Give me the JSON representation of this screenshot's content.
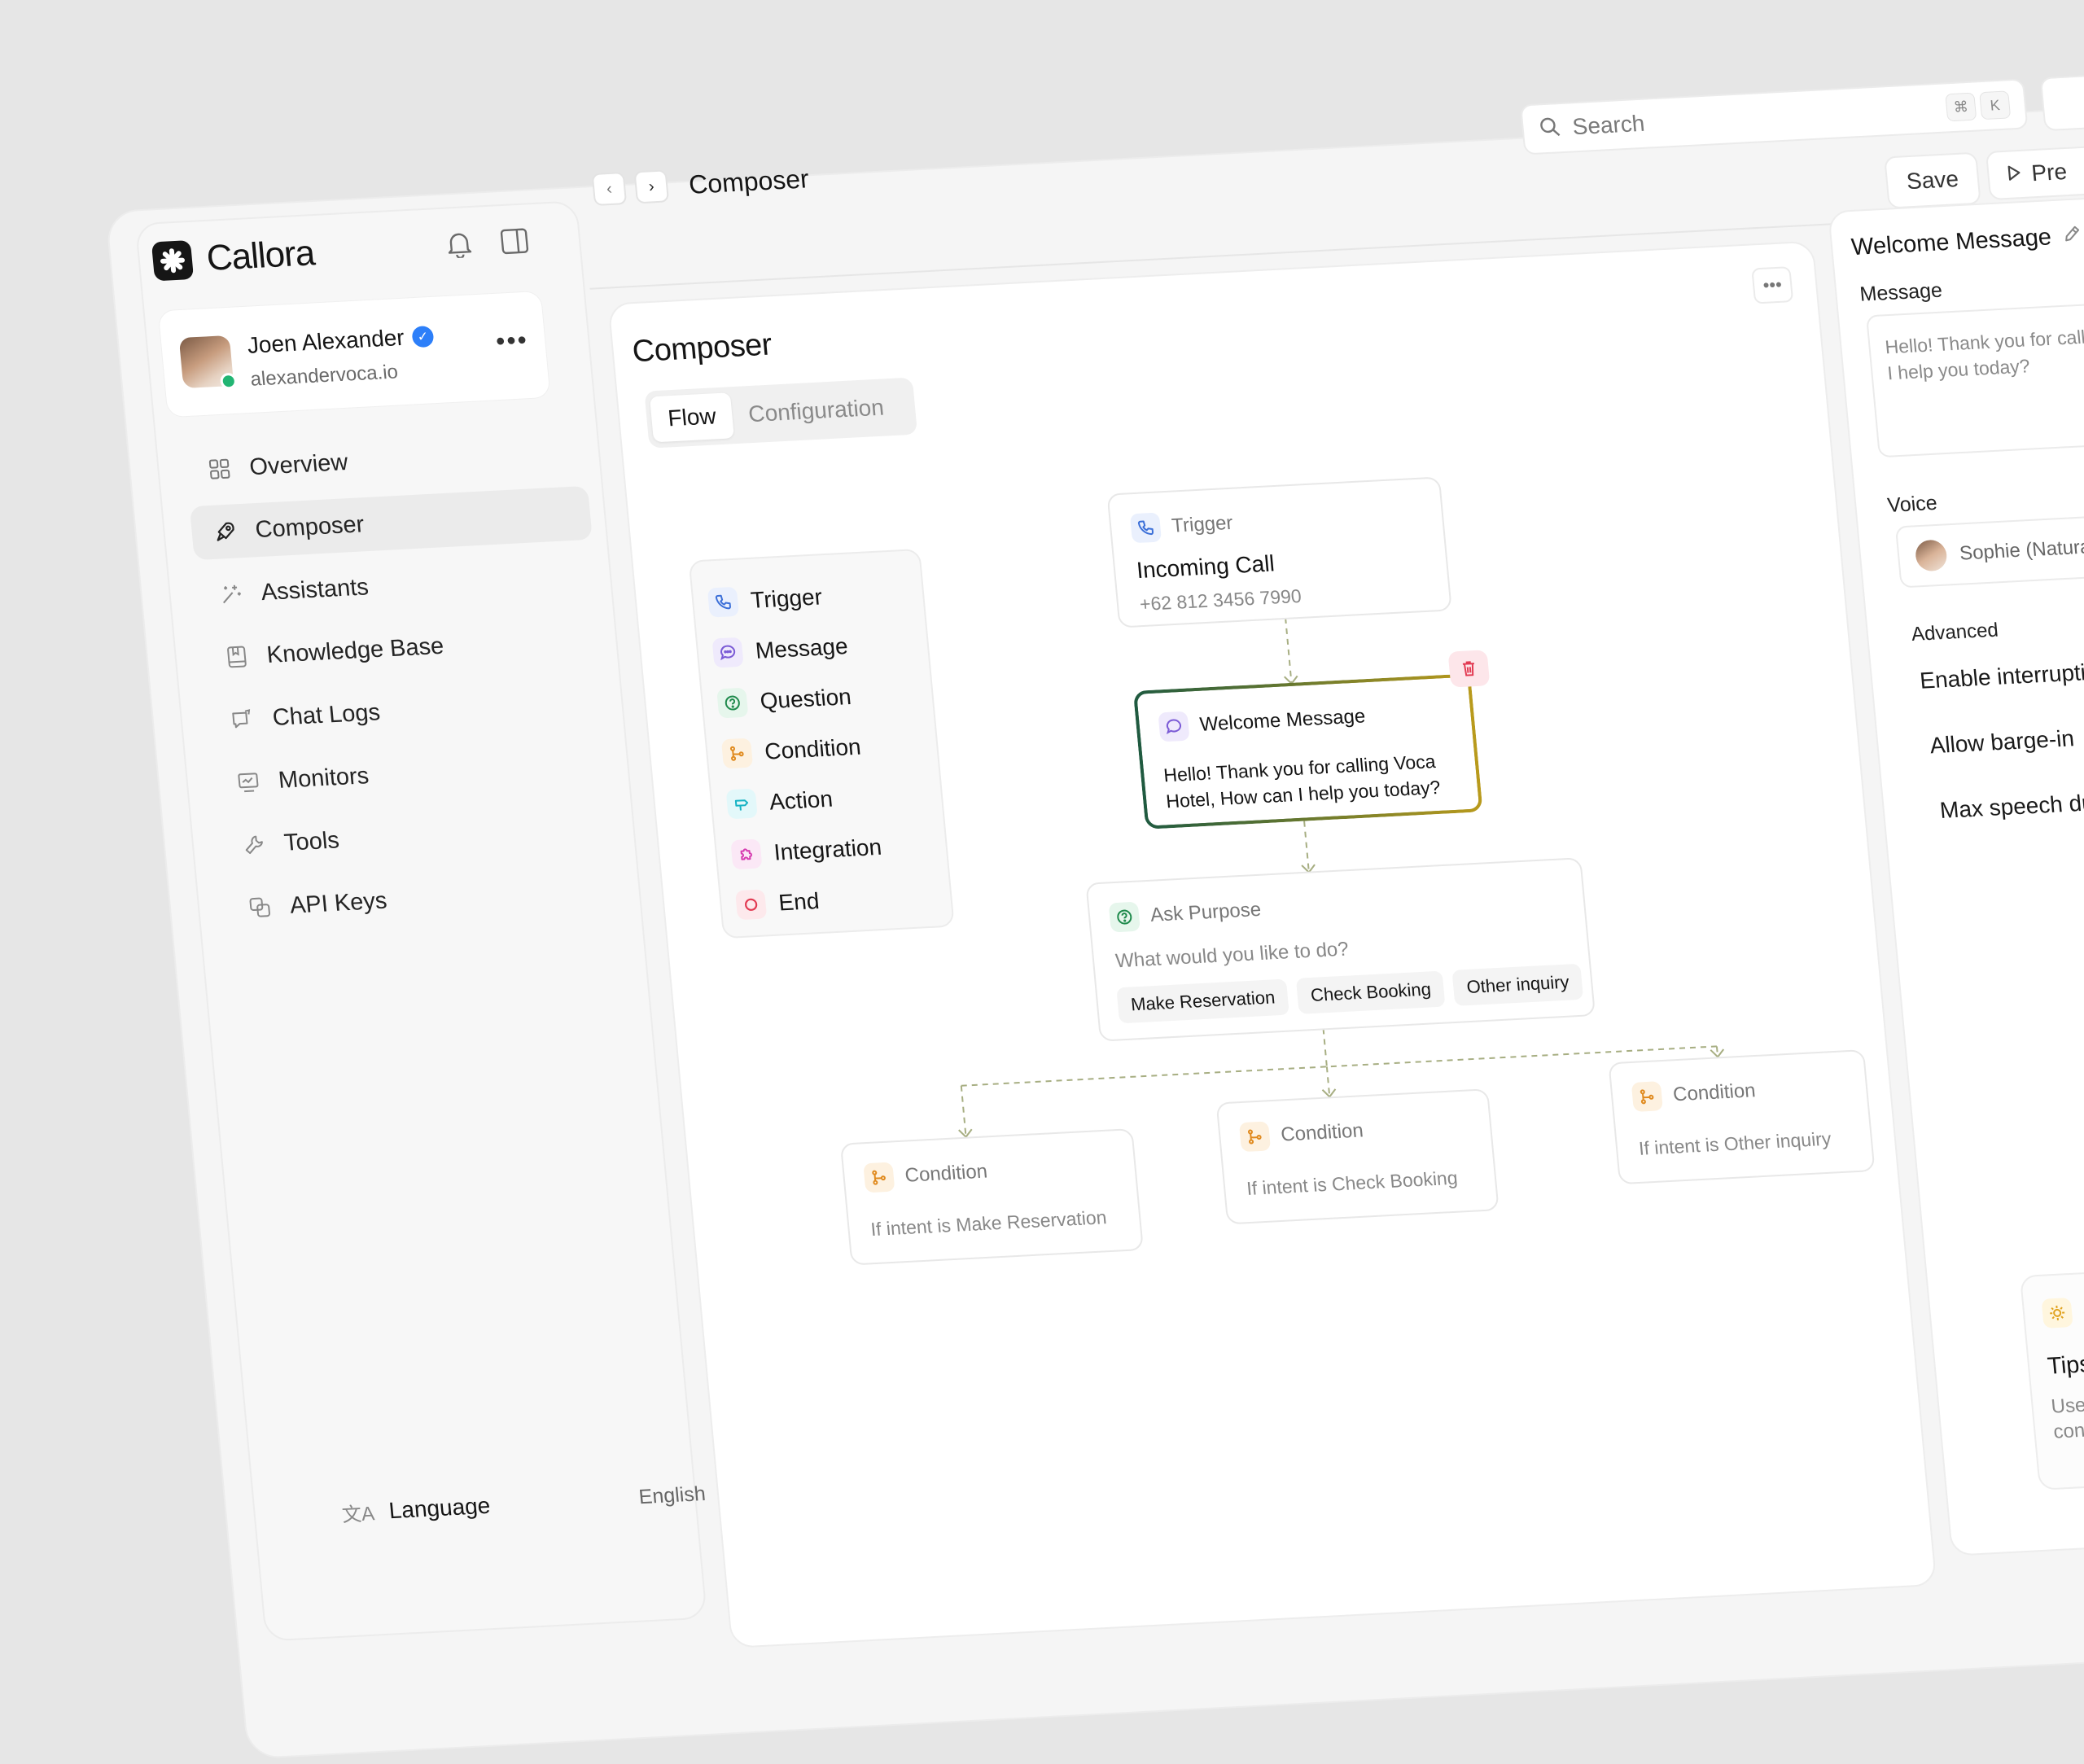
{
  "app": {
    "name": "Callora"
  },
  "user": {
    "name": "Joen Alexander",
    "email": "alexandervoca.io"
  },
  "nav": {
    "items": [
      {
        "label": "Overview",
        "icon": "grid-icon"
      },
      {
        "label": "Composer",
        "icon": "rocket-icon",
        "active": true
      },
      {
        "label": "Assistants",
        "icon": "sparkle-icon"
      },
      {
        "label": "Knowledge Base",
        "icon": "book-icon"
      },
      {
        "label": "Chat Logs",
        "icon": "chat-icon"
      },
      {
        "label": "Monitors",
        "icon": "monitor-icon"
      },
      {
        "label": "Tools",
        "icon": "wrench-icon"
      },
      {
        "label": "API Keys",
        "icon": "keys-icon"
      }
    ],
    "language_label": "Language",
    "language_value": "English"
  },
  "topbar": {
    "breadcrumb": "Composer",
    "search_placeholder": "Search",
    "shortcut_keys": [
      "⌘",
      "K"
    ],
    "save_label": "Save",
    "preview_label": "Pre"
  },
  "composer": {
    "title": "Composer",
    "tabs": [
      {
        "label": "Flow",
        "active": true
      },
      {
        "label": "Configuration"
      }
    ],
    "palette": [
      {
        "label": "Trigger",
        "icon": "phone-icon",
        "color": "#3b6fd8",
        "bg": "#eaf0fd"
      },
      {
        "label": "Message",
        "icon": "chat-bubble-icon",
        "color": "#7b5bd6",
        "bg": "#efeafc"
      },
      {
        "label": "Question",
        "icon": "question-icon",
        "color": "#1f8a4c",
        "bg": "#e6f6ec"
      },
      {
        "label": "Condition",
        "icon": "branch-icon",
        "color": "#e08a1e",
        "bg": "#fdf1e0"
      },
      {
        "label": "Action",
        "icon": "signpost-icon",
        "color": "#16b3c4",
        "bg": "#e3f8fa"
      },
      {
        "label": "Integration",
        "icon": "puzzle-icon",
        "color": "#d63bb0",
        "bg": "#fbe8f6"
      },
      {
        "label": "End",
        "icon": "stop-circle-icon",
        "color": "#e23a52",
        "bg": "#fde9ec"
      }
    ]
  },
  "flow": {
    "trigger_node": {
      "type": "Trigger",
      "title": "Incoming Call",
      "phone": "+62 812 3456 7990"
    },
    "welcome_node": {
      "title": "Welcome Message",
      "text_line1": "Hello! Thank you for calling Voca",
      "text_line2": "Hotel, How can I help you today?"
    },
    "question_node": {
      "title": "Ask Purpose",
      "prompt": "What would you like to do?",
      "options": [
        "Make Reservation",
        "Check Booking",
        "Other inquiry"
      ]
    },
    "conditions": [
      {
        "title": "Condition",
        "text": "If intent is Make Reservation"
      },
      {
        "title": "Condition",
        "text": "If intent is Check Booking"
      },
      {
        "title": "Condition",
        "text": "If intent is Other inquiry"
      }
    ]
  },
  "panel": {
    "title": "Welcome Message",
    "message_label": "Message",
    "message_line1": "Hello! Thank you for calling",
    "message_line2": "I help you today?",
    "voice_label": "Voice",
    "voice_value": "Sophie (Natural)",
    "advanced_label": "Advanced",
    "advanced_items": [
      "Enable interruption",
      "Allow barge-in",
      "Max speech duration"
    ],
    "tips_title": "Tips",
    "tips_line1": "Use variables to",
    "tips_line2": "conversations n"
  },
  "colors": {
    "accent_green": "#1f5a40",
    "accent_gold": "#b99a1c",
    "connector": "#a7ae82",
    "online": "#22b573",
    "verified": "#2d7ff9"
  }
}
